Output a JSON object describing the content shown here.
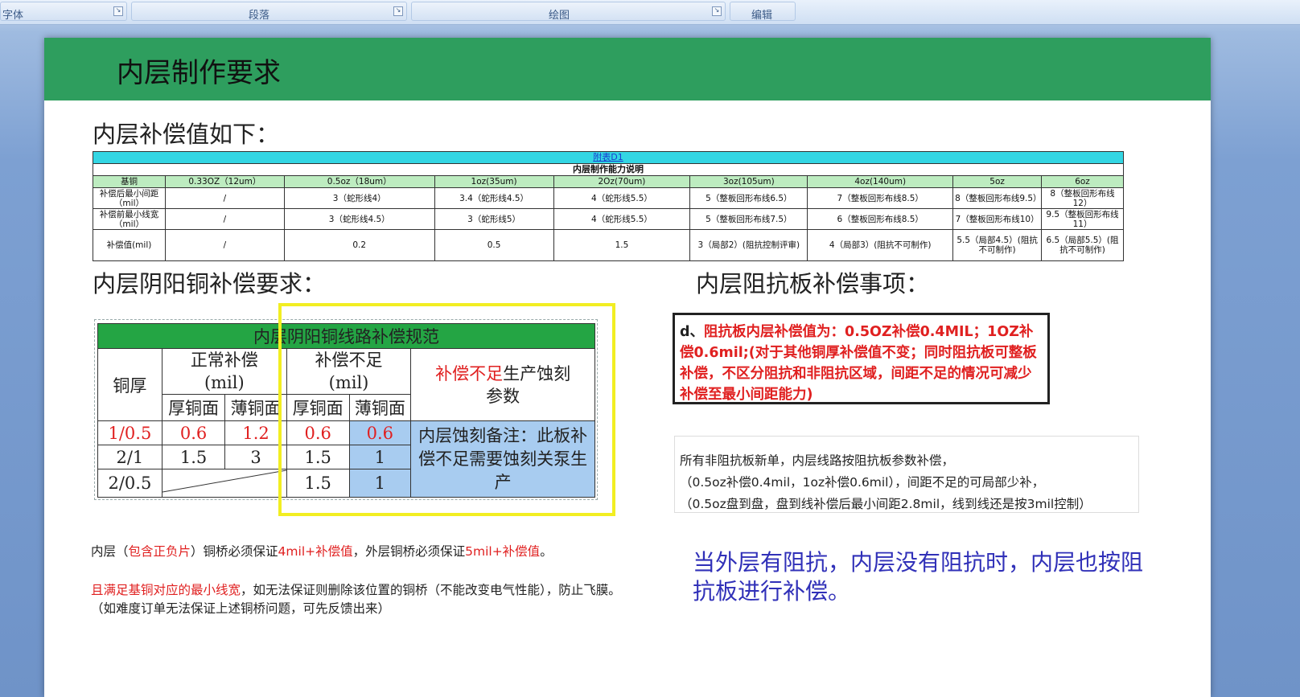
{
  "ribbon": {
    "groups": [
      {
        "label": "字体"
      },
      {
        "label": "段落"
      },
      {
        "label": "绘图"
      },
      {
        "label": "编辑"
      }
    ]
  },
  "slide": {
    "title": "内层制作要求",
    "section1_heading": "内层补偿值如下：",
    "capability_table": {
      "link_text": "附表D1",
      "caption": "内层制作能力说明",
      "headers": [
        "基铜",
        "0.33OZ（12um）",
        "0.5oz（18um）",
        "1oz(35um)",
        "2Oz(70um)",
        "3oz(105um)",
        "4oz(140um)",
        "5oz",
        "6oz"
      ],
      "rows": [
        [
          "补偿后最小间距（mil）",
          "/",
          "3（蛇形线4）",
          "3.4（蛇形线4.5）",
          "4（蛇形线5.5）",
          "5（整板回形布线6.5）",
          "7（整板回形布线8.5）",
          "8（整板回形布线9.5）",
          "8（整板回形布线12）"
        ],
        [
          "补偿前最小线宽（mil）",
          "/",
          "3（蛇形线4.5）",
          "3（蛇形线5）",
          "4（蛇形线5.5）",
          "5（整板回形布线7.5）",
          "6（整板回形布线8.5）",
          "7（整板回形布线10）",
          "9.5（整板回形布线11）"
        ],
        [
          "补偿值(mil)",
          "/",
          "0.2",
          "0.5",
          "1.5",
          "3（局部2）(阻抗控制评审)",
          "4（局部3）(阻抗不可制作)",
          "5.5（局部4.5）(阻抗不可制作)",
          "6.5（局部5.5）(阻抗不可制作)"
        ]
      ]
    },
    "section2_heading": "内层阴阳铜补偿要求：",
    "section3_heading": "内层阻抗板补偿事项：",
    "yinyang_table": {
      "title": "内层阴阳铜线路补偿规范",
      "col_thickness": "铜厚",
      "col_normal": "正常补偿",
      "col_normal_unit": "(mil)",
      "col_insufficient": "补偿不足",
      "col_insufficient_unit": "(mil)",
      "col_param_red": "补偿不足",
      "col_param_rest1": "生产蚀刻",
      "col_param_rest2": "参数",
      "sub_thick": "厚铜面",
      "sub_thin": "薄铜面",
      "sub_thick2": "厚铜面",
      "sub_thin2": "薄铜面",
      "rows": [
        {
          "thickness": "1/0.5",
          "n_thick": "0.6",
          "n_thin": "1.2",
          "i_thick": "0.6",
          "i_thin": "0.6"
        },
        {
          "thickness": "2/1",
          "n_thick": "1.5",
          "n_thin": "3",
          "i_thick": "1.5",
          "i_thin": "1"
        },
        {
          "thickness": "2/0.5",
          "n_thick": "",
          "n_thin": "",
          "i_thick": "1.5",
          "i_thin": "1"
        }
      ],
      "remark": "内层蚀刻备注：此板补偿不足需要蚀刻关泵生产"
    },
    "impedance_note": {
      "prefix": "d、",
      "text": "阻抗板内层补偿值为：0.5OZ补偿0.4MIL；1OZ补偿0.6mil;(对于其他铜厚补偿值不变；同时阻抗板可整板补偿，不区分阻抗和非阻抗区域，间距不足的情况可减少补偿至最小间距能力)"
    },
    "non_impedance_note": {
      "line1": "所有非阻抗板新单，内层线路按阻抗板参数补偿，",
      "line2": "（0.5oz补偿0.4mil，1oz补偿0.6mil），间距不足的可局部少补，",
      "line3": "（0.5oz盘到盘，盘到线补偿后最小间距2.8mil，线到线还是按3mil控制）"
    },
    "bridge_note": {
      "p1": "内层（",
      "p1_red": "包含正负片",
      "p2": "）铜桥必须保证",
      "p2_red": "4mil+补偿值",
      "p3": "，外层铜桥必须保证",
      "p3_red": "5mil+补偿值",
      "p4": "。",
      "line2_red": "且满足基铜对应的最小线宽",
      "line2_rest": "，如无法保证则删除该位置的铜桥（不能改变电气性能），防止飞膜。",
      "line3": "（如难度订单无法保证上述铜桥问题，可先反馈出来）"
    },
    "outer_layer_note": "当外层有阻抗，内层没有阻抗时，内层也按阻抗板进行补偿。"
  }
}
